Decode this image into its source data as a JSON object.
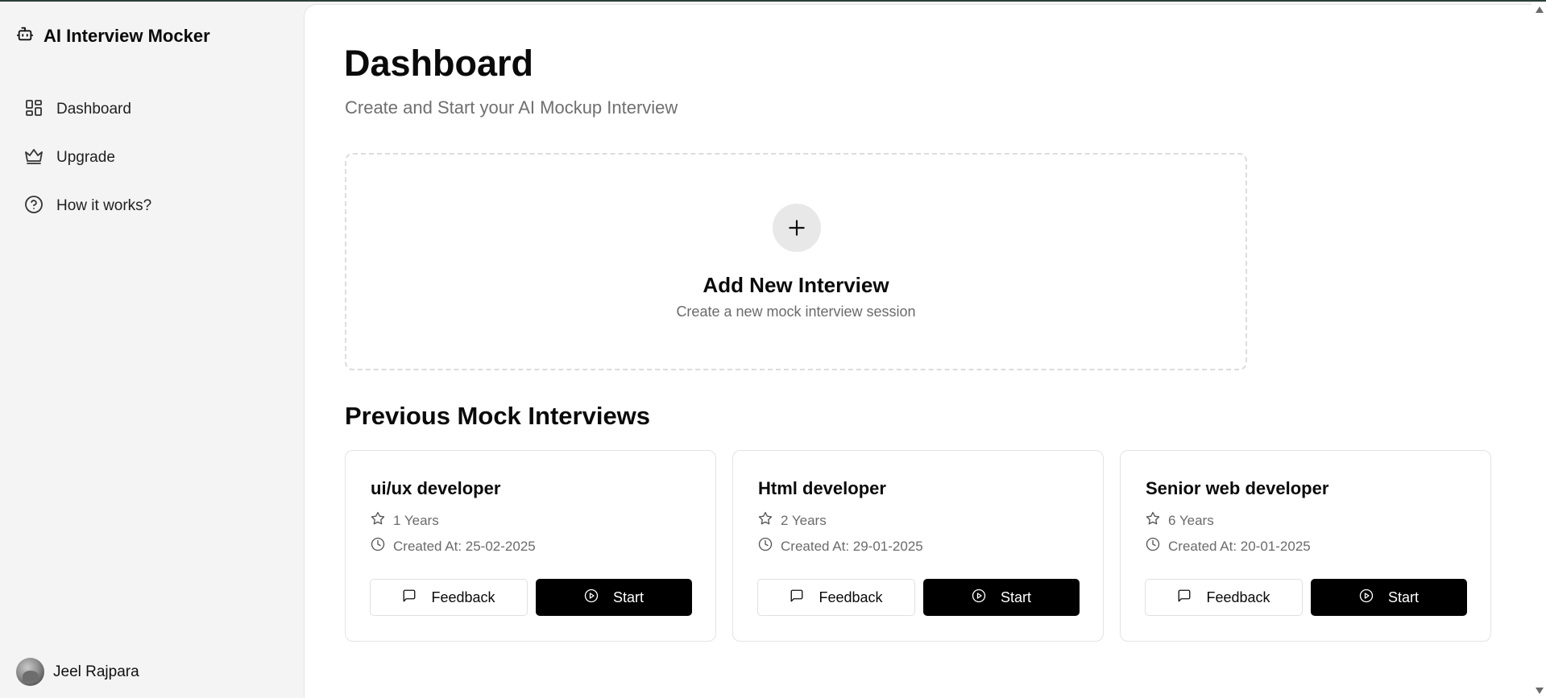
{
  "app": {
    "title": "AI Interview Mocker",
    "logo_icon": "bot-icon"
  },
  "sidebar": {
    "items": [
      {
        "label": "Dashboard",
        "icon": "dashboard-grid-icon"
      },
      {
        "label": "Upgrade",
        "icon": "crown-icon"
      },
      {
        "label": "How it works?",
        "icon": "help-circle-icon"
      }
    ],
    "user": {
      "name": "Jeel Rajpara"
    }
  },
  "header": {
    "title": "Dashboard",
    "subtitle": "Create and Start your AI Mockup Interview"
  },
  "add_interview": {
    "title": "Add New Interview",
    "subtitle": "Create a new mock interview session"
  },
  "previous": {
    "title": "Previous Mock Interviews",
    "cards": [
      {
        "role": "ui/ux developer",
        "experience": "1 Years",
        "created": "Created At: 25-02-2025",
        "feedback_label": "Feedback",
        "start_label": "Start"
      },
      {
        "role": "Html developer",
        "experience": "2 Years",
        "created": "Created At: 29-01-2025",
        "feedback_label": "Feedback",
        "start_label": "Start"
      },
      {
        "role": "Senior web developer",
        "experience": "6 Years",
        "created": "Created At: 20-01-2025",
        "feedback_label": "Feedback",
        "start_label": "Start"
      }
    ]
  },
  "colors": {
    "accent": "#000000",
    "sidebar_bg": "#f4f4f4",
    "muted_text": "#6b6b6b"
  }
}
